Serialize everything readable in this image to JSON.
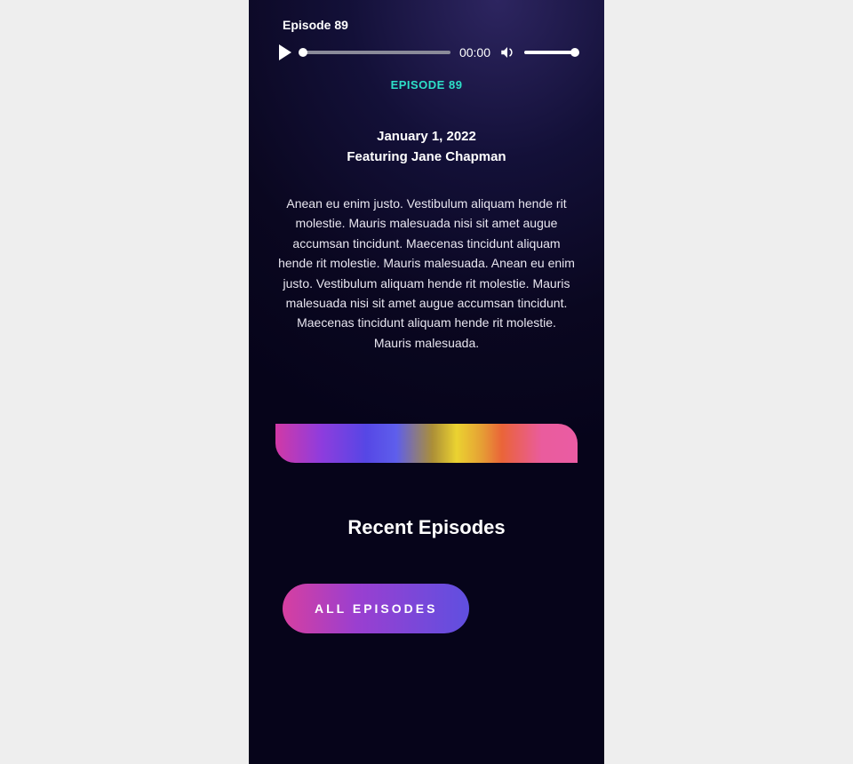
{
  "player": {
    "title": "Episode 89",
    "time": "00:00"
  },
  "episode": {
    "label": "EPISODE 89",
    "date": "January 1, 2022",
    "featuring": "Featuring Jane Chapman",
    "description": "Anean eu enim justo. Vestibulum aliquam hende rit molestie. Mauris malesuada nisi sit amet augue accumsan tincidunt. Maecenas tincidunt aliquam hende rit molestie. Mauris malesuada. Anean eu enim justo. Vestibulum aliquam hende rit molestie. Mauris malesuada nisi sit amet augue accumsan tincidunt. Maecenas tincidunt aliquam hende rit molestie. Mauris malesuada."
  },
  "recent": {
    "title": "Recent Episodes",
    "button": "ALL EPISODES"
  },
  "colors": {
    "accent": "#2de0c8"
  }
}
